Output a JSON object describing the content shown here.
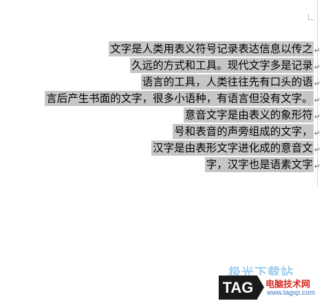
{
  "document": {
    "lines": [
      "文字是人类用表义符号记录表达信息以传之",
      "久远的方式和工具。现代文字多是记录",
      "语言的工具，人类往往先有口头的语",
      "言后产生书面的文字，很多小语种，有语言但没有文字。",
      "意音文字是由表义的象形符",
      "号和表音的声旁组成的文字，",
      "汉字是由表形文字进化成的意音文",
      "字，汉字也是语素文字"
    ],
    "paragraph_mark": "↵",
    "selection_color": "#c6c6c6"
  },
  "watermark": {
    "top_text": "极光下载站",
    "badge": "TAG",
    "site_name": "电脑技术网",
    "url": "www.tagxp.com"
  }
}
